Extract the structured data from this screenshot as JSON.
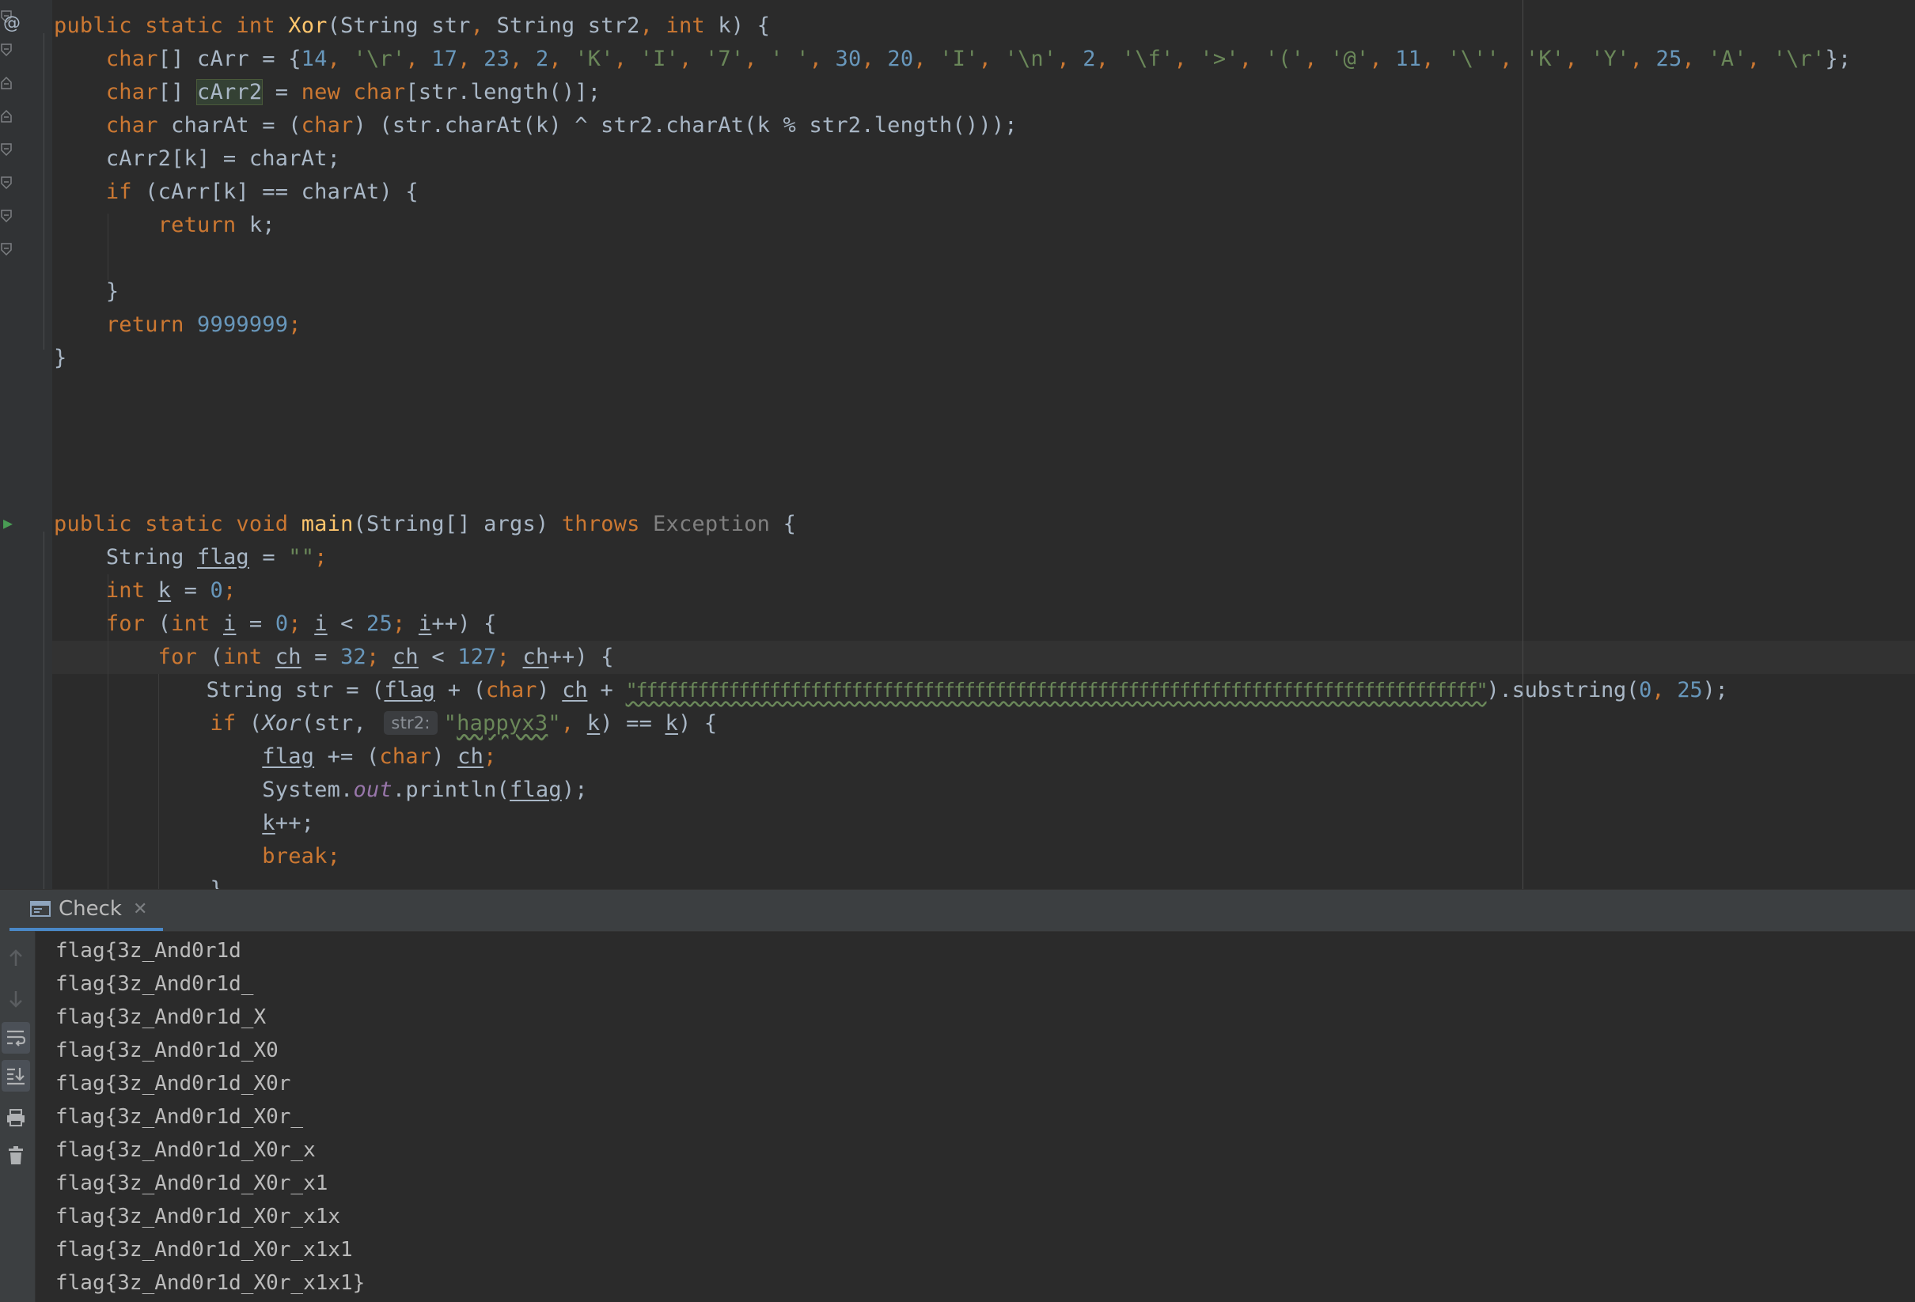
{
  "editor": {
    "gutter": {
      "override_marker": "@",
      "run_marker": "play-icon"
    },
    "code": {
      "xor_decl": {
        "public": "public",
        "static": "static",
        "int": "int",
        "name": "Xor",
        "params_open": "(String str",
        "comma1": ",",
        "param2": " String str2",
        "comma2": ",",
        "int2": "int",
        "params_close": " k) {"
      },
      "carr_line": {
        "type": "char",
        "rest": "[] cArr = {",
        "items": [
          {
            "t": "num",
            "v": "14"
          },
          {
            "t": "p",
            "v": ", "
          },
          {
            "t": "str",
            "v": "'\\r'"
          },
          {
            "t": "p",
            "v": ", "
          },
          {
            "t": "num",
            "v": "17"
          },
          {
            "t": "p",
            "v": ", "
          },
          {
            "t": "num",
            "v": "23"
          },
          {
            "t": "p",
            "v": ", "
          },
          {
            "t": "num",
            "v": "2"
          },
          {
            "t": "p",
            "v": ", "
          },
          {
            "t": "str",
            "v": "'K'"
          },
          {
            "t": "p",
            "v": ", "
          },
          {
            "t": "str",
            "v": "'I'"
          },
          {
            "t": "p",
            "v": ", "
          },
          {
            "t": "str",
            "v": "'7'"
          },
          {
            "t": "p",
            "v": ", "
          },
          {
            "t": "str",
            "v": "' '"
          },
          {
            "t": "p",
            "v": ", "
          },
          {
            "t": "num",
            "v": "30"
          },
          {
            "t": "p",
            "v": ", "
          },
          {
            "t": "num",
            "v": "20"
          },
          {
            "t": "p",
            "v": ", "
          },
          {
            "t": "str",
            "v": "'I'"
          },
          {
            "t": "p",
            "v": ", "
          },
          {
            "t": "str",
            "v": "'\\n'"
          },
          {
            "t": "p",
            "v": ", "
          },
          {
            "t": "num",
            "v": "2"
          },
          {
            "t": "p",
            "v": ", "
          },
          {
            "t": "str",
            "v": "'\\f'"
          },
          {
            "t": "p",
            "v": ", "
          },
          {
            "t": "str",
            "v": "'>'"
          },
          {
            "t": "p",
            "v": ", "
          },
          {
            "t": "str",
            "v": "'('"
          },
          {
            "t": "p",
            "v": ", "
          },
          {
            "t": "str",
            "v": "'@'"
          },
          {
            "t": "p",
            "v": ", "
          },
          {
            "t": "num",
            "v": "11"
          },
          {
            "t": "p",
            "v": ", "
          },
          {
            "t": "str",
            "v": "'\\''"
          },
          {
            "t": "p",
            "v": ", "
          },
          {
            "t": "str",
            "v": "'K'"
          },
          {
            "t": "p",
            "v": ", "
          },
          {
            "t": "str",
            "v": "'Y'"
          },
          {
            "t": "p",
            "v": ", "
          },
          {
            "t": "num",
            "v": "25"
          },
          {
            "t": "p",
            "v": ", "
          },
          {
            "t": "str",
            "v": "'A'"
          },
          {
            "t": "p",
            "v": ", "
          },
          {
            "t": "str",
            "v": "'\\r'"
          },
          {
            "t": "p",
            "v": "};"
          }
        ]
      },
      "carr2_line": {
        "type": "char",
        "mid": "[] ",
        "var": "cArr2",
        "eq": " = ",
        "new": "new",
        "type2": "char",
        "rest": "[str.length()];"
      },
      "charat_line": {
        "type": "char",
        "mid": " charAt = (",
        "cast": "char",
        "rest": ") (str.charAt(k) ^ str2.charAt(k % str2.length()));"
      },
      "assign_line": "cArr2[k] = charAt;",
      "if_line": {
        "kw": "if",
        "rest": " (cArr[k] == charAt) {"
      },
      "return_k": {
        "kw": "return",
        "rest": " k;"
      },
      "close1": "}",
      "return_big": {
        "kw": "return",
        "num": "9999999",
        "end": ";"
      },
      "close2": "}",
      "main_decl": {
        "public": "public",
        "static": "static",
        "void": "void",
        "name": "main",
        "params": "(String[] args) ",
        "throws": "throws",
        "exc": "Exception",
        "end": " {"
      },
      "flag_line": {
        "type": "String ",
        "var": "flag",
        "eq": " = ",
        "val": "\"\"",
        "end": ";"
      },
      "k_line": {
        "kw": "int",
        "sp": " ",
        "var": "k",
        "eq": " = ",
        "num": "0",
        "end": ";"
      },
      "for1": {
        "kw": "for",
        "p1": " (",
        "int": "int",
        "sp": " ",
        "i": "i",
        "eq": " = ",
        "n0": "0",
        "semi": "; ",
        "i2": "i",
        "lt": " < ",
        "n25": "25",
        "semi2": "; ",
        "i3": "i",
        "inc": "++) {"
      },
      "for2": {
        "kw": "for",
        "p1": " (",
        "int": "int",
        "sp": " ",
        "ch": "ch",
        "eq": " = ",
        "n32": "32",
        "semi": "; ",
        "ch2": "ch",
        "lt": " < ",
        "n127": "127",
        "semi2": "; ",
        "ch3": "ch",
        "inc": "++) {"
      },
      "str_line": {
        "a": "String str = (",
        "flag": "flag",
        "b": " + (",
        "char": "char",
        "c": ") ",
        "ch": "ch",
        "d": " + ",
        "lit": "\"ffffffffffffffffffffffffffffffffffffffffffffffffffffffffffffffffffffffffffffffffff\"",
        "e": ").substring(",
        "n0": "0",
        "f": ", ",
        "n25": "25",
        "g": ");"
      },
      "if2": {
        "kw": "if",
        "a": " (",
        "fn": "Xor",
        "b": "(str, ",
        "hint": "str2:",
        "q1": "\"",
        "lit": "happyx3",
        "q2": "\"",
        "c": ", ",
        "k": "k",
        "d": ") == ",
        "k2": "k",
        "e": ") {"
      },
      "flag_add": {
        "flag": "flag",
        "a": " += (",
        "char": "char",
        "b": ") ",
        "ch": "ch",
        "end": ";"
      },
      "println": {
        "a": "System.",
        "out": "out",
        "b": ".println(",
        "flag": "flag",
        "c": ");"
      },
      "kinc": {
        "k": "k",
        "end": "++;"
      },
      "brk": {
        "kw": "break",
        "end": ";"
      },
      "partial": "}"
    }
  },
  "tool_window": {
    "tab_label": "Check",
    "tab_close": "✕",
    "output": [
      "flag{3z_And0r1d",
      "flag{3z_And0r1d_",
      "flag{3z_And0r1d_X",
      "flag{3z_And0r1d_X0",
      "flag{3z_And0r1d_X0r",
      "flag{3z_And0r1d_X0r_",
      "flag{3z_And0r1d_X0r_x",
      "flag{3z_And0r1d_X0r_x1",
      "flag{3z_And0r1d_X0r_x1x",
      "flag{3z_And0r1d_X0r_x1x1",
      "flag{3z_And0r1d_X0r_x1x1}"
    ],
    "side_buttons": [
      "arrow-up-icon",
      "arrow-down-icon",
      "soft-wrap-icon",
      "scroll-to-end-icon",
      "print-icon",
      "trash-icon"
    ]
  }
}
